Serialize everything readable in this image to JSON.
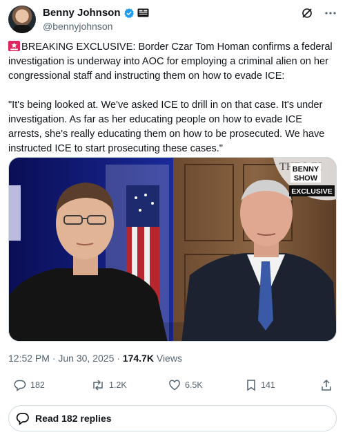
{
  "author": {
    "display_name": "Benny Johnson",
    "handle": "@bennyjohnson"
  },
  "tweet": {
    "emoji": "siren",
    "text": "BREAKING EXCLUSIVE: Border Czar Tom Homan confirms a federal investigation is underway into AOC for employing a criminal alien on her congressional staff and instructing them on how to evade ICE:\n\n\"It's being looked at. We've asked ICE to drill in on that case. It's under investigation. As far as her educating people on how to evade ICE arrests, she's really educating them on how to be prosecuted. We have instructed ICE to start prosecuting these cases.\""
  },
  "media": {
    "logo_top": "BENNY",
    "logo_bottom": "SHOW",
    "badge": "EXCLUSIVE",
    "seal_text": "THE WH"
  },
  "meta": {
    "time": "12:52 PM",
    "sep1": "·",
    "date": "Jun 30, 2025",
    "sep2": "·",
    "views_count": "174.7K",
    "views_label": "Views"
  },
  "actions": {
    "replies": "182",
    "reposts": "1.2K",
    "likes": "6.5K",
    "bookmarks": "141"
  },
  "read_replies": "Read 182 replies",
  "colors": {
    "verified": "#1d9bf0",
    "text": "#0f1419",
    "muted": "#536471",
    "border": "#cfd9de"
  }
}
